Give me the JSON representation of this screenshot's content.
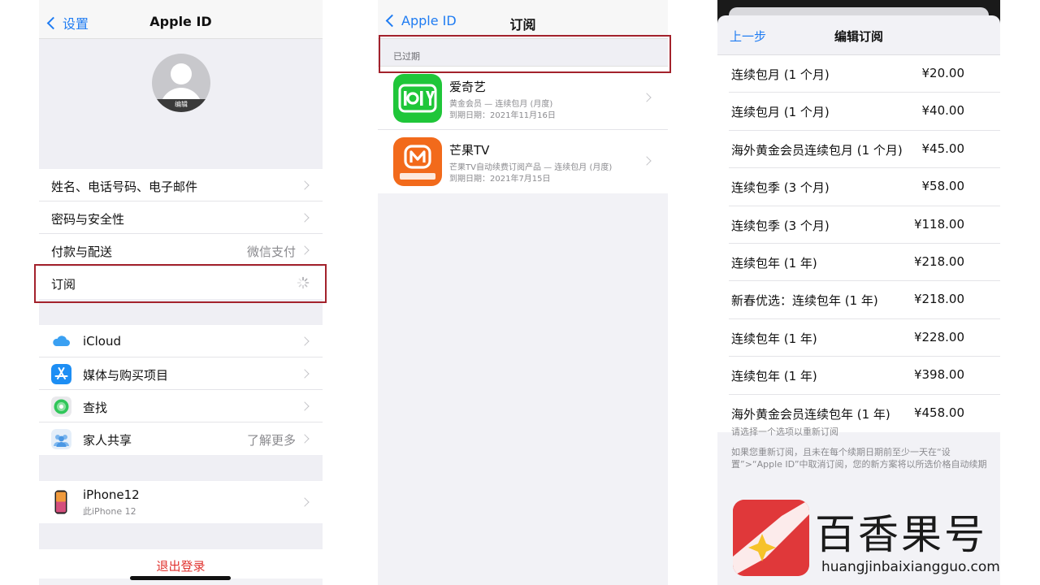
{
  "panel1": {
    "nav": {
      "back_label": "设置",
      "title": "Apple ID"
    },
    "avatar": {
      "edit_label": "编辑"
    },
    "account_rows": [
      {
        "label": "姓名、电话号码、电子邮件",
        "value": ""
      },
      {
        "label": "密码与安全性",
        "value": ""
      },
      {
        "label": "付款与配送",
        "value": "微信支付"
      },
      {
        "label": "订阅",
        "value": ""
      }
    ],
    "service_rows": [
      {
        "label": "iCloud",
        "value": "",
        "icon": "cloud-icon"
      },
      {
        "label": "媒体与购买项目",
        "value": "",
        "icon": "app-store-icon"
      },
      {
        "label": "查找",
        "value": "",
        "icon": "find-my-icon"
      },
      {
        "label": "家人共享",
        "value": "了解更多",
        "icon": "family-icon"
      }
    ],
    "device": {
      "name": "iPhone12",
      "sub": "此iPhone 12"
    },
    "signout_label": "退出登录"
  },
  "panel2": {
    "nav": {
      "back_label": "Apple ID",
      "title": "订阅"
    },
    "section_header": "已过期",
    "subscriptions": [
      {
        "name": "爱奇艺",
        "line1": "黄金会员 — 连续包月 (月度)",
        "line2": "到期日期：2021年11月16日",
        "icon": "iqiyi-icon"
      },
      {
        "name": "芒果TV",
        "line1": "芒果TV自动续费订阅产品 — 连续包月 (月度)",
        "line2": "到期日期：2021年7月15日",
        "icon": "mango-tv-icon"
      }
    ]
  },
  "panel3": {
    "back_label": "上一步",
    "title": "编辑订阅",
    "options": [
      {
        "name": "连续包月 (1 个月)",
        "price": "¥20.00"
      },
      {
        "name": "连续包月 (1 个月)",
        "price": "¥40.00"
      },
      {
        "name": "海外黄金会员连续包月 (1 个月)",
        "price": "¥45.00"
      },
      {
        "name": "连续包季 (3 个月)",
        "price": "¥58.00"
      },
      {
        "name": "连续包季 (3 个月)",
        "price": "¥118.00"
      },
      {
        "name": "连续包年 (1 年)",
        "price": "¥218.00"
      },
      {
        "name": "新春优选：连续包年 (1 年)",
        "price": "¥218.00"
      },
      {
        "name": "连续包年 (1 年)",
        "price": "¥228.00"
      },
      {
        "name": "连续包年 (1 年)",
        "price": "¥398.00"
      },
      {
        "name": "海外黄金会员连续包年 (1 年)",
        "price": "¥458.00"
      }
    ],
    "footer_hint": "请选择一个选项以重新订阅",
    "footer_note": "如果您重新订阅，且未在每个续期日期前至少一天在“设置”>“Apple ID”中取消订阅，您的新方案将以所选价格自动续期"
  },
  "watermark": {
    "text": "百香果号",
    "url": "huangjinbaixiangguo.com"
  },
  "colors": {
    "ios_blue": "#1f7cf2",
    "highlight_red": "#a3222c",
    "signout_red": "#e0332f",
    "iqiyi_green": "#1fc639",
    "mango_orange": "#f26a1b"
  }
}
